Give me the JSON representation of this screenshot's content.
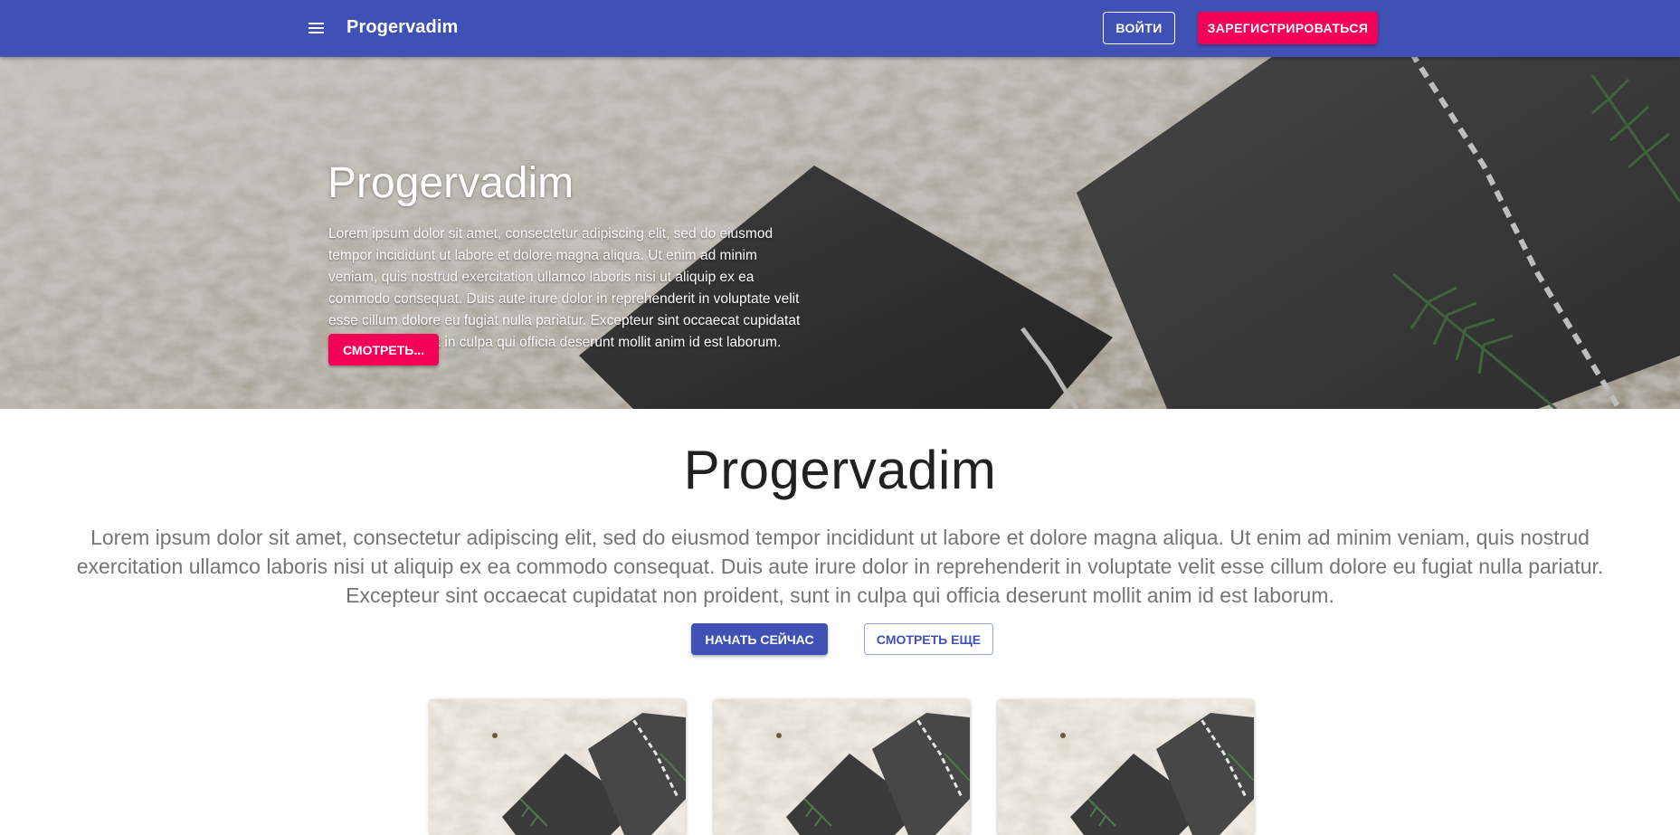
{
  "appbar": {
    "brand": "Progervadim",
    "login_label": "ВОЙТИ",
    "register_label": "ЗАРЕГИСТРИРОВАТЬСЯ"
  },
  "hero": {
    "title": "Progervadim",
    "text": "Lorem ipsum dolor sit amet, consectetur adipiscing elit, sed do eiusmod tempor incididunt ut labore et dolore magna aliqua. Ut enim ad minim veniam, quis nostrud exercitation ullamco laboris nisi ut aliquip ex ea commodo consequat. Duis aute irure dolor in reprehenderit in voluptate velit esse cillum dolore eu fugiat nulla pariatur. Excepteur sint occaecat cupidatat non proident, sunt in culpa qui officia deserunt mollit anim id est laborum.",
    "button_label": "СМОТРЕТЬ..."
  },
  "intro": {
    "title": "Progervadim",
    "text": "Lorem ipsum dolor sit amet, consectetur adipiscing elit, sed do eiusmod tempor incididunt ut labore et dolore magna aliqua. Ut enim ad minim veniam, quis nostrud exercitation ullamco laboris nisi ut aliquip ex ea commodo consequat. Duis aute irure dolor in reprehenderit in voluptate velit esse cillum dolore eu fugiat nulla pariatur. Excepteur sint occaecat cupidatat non proident, sunt in culpa qui officia deserunt mollit anim id est laborum.",
    "start_label": "НАЧАТЬ СЕЙЧАС",
    "more_label": "СМОТРЕТЬ ЕЩЕ"
  },
  "icons": {
    "menu": "menu-icon"
  },
  "colors": {
    "primary": "#3f51b5",
    "secondary": "#f50057",
    "text_secondary": "#757575"
  }
}
